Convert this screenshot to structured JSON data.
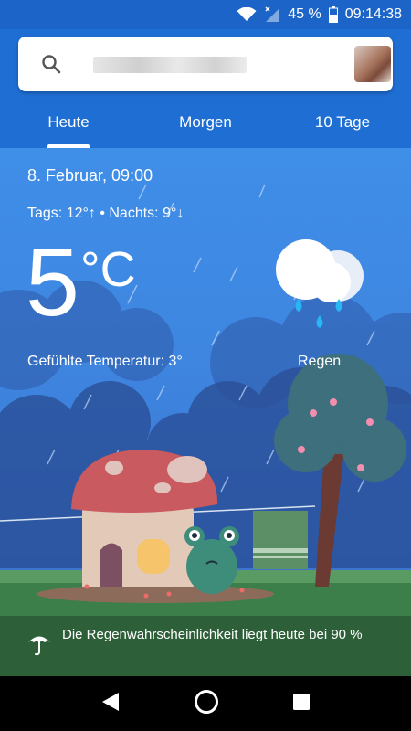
{
  "status_bar": {
    "battery": "45 %",
    "time": "09:14:38",
    "icons": [
      "wifi-icon",
      "signal-icon",
      "battery-icon"
    ]
  },
  "search": {
    "icon": "search-icon"
  },
  "tabs": [
    {
      "label": "Heute",
      "active": true
    },
    {
      "label": "Morgen",
      "active": false
    },
    {
      "label": "10 Tage",
      "active": false
    }
  ],
  "weather": {
    "date": "8. Februar, 09:00",
    "hilo": "Tags: 12°↑ • Nachts: 9°↓",
    "temperature": "5",
    "unit": "°C",
    "feels_like": "Gefühlte Temperatur: 3°",
    "condition": "Regen",
    "condition_icon": "rain-cloud-icon"
  },
  "footer": {
    "icon": "umbrella-icon",
    "text": "Die Regenwahrscheinlichkeit liegt heute bei 90 %"
  },
  "navbar": {
    "icons": [
      "back-icon",
      "home-icon",
      "recents-icon"
    ]
  },
  "colors": {
    "header": "#1f6ed4",
    "sky": "#3f8ee8",
    "rain_drop": "#29b6f6"
  }
}
